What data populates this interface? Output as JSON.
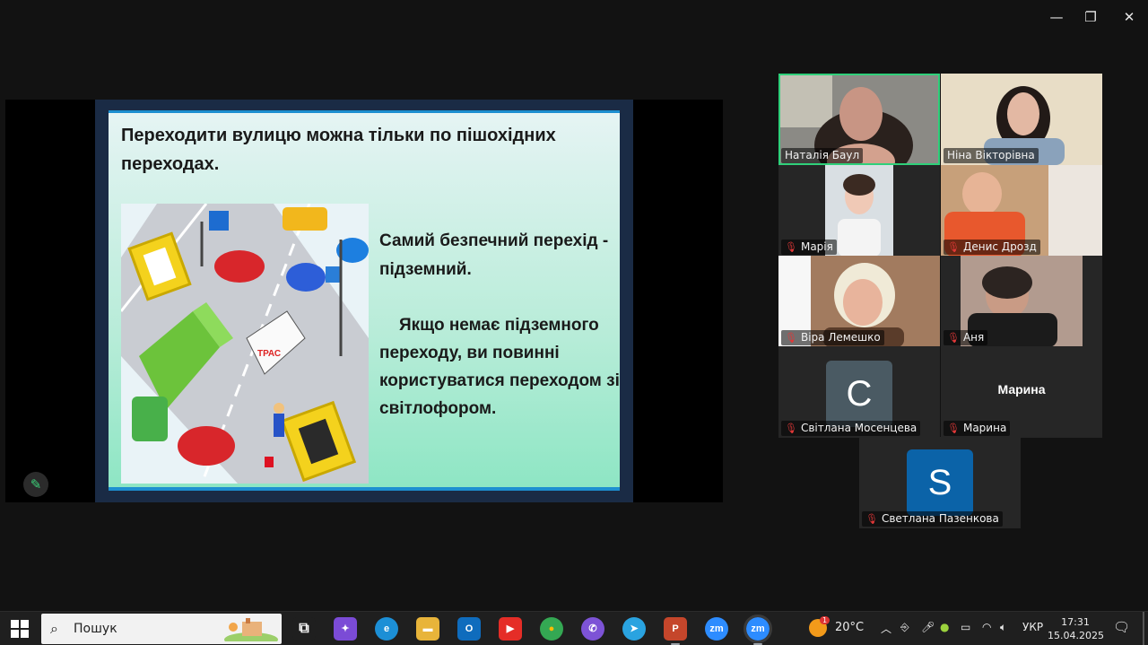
{
  "window": {
    "minimize_glyph": "—",
    "maximize_glyph": "❐",
    "close_glyph": "✕"
  },
  "slide": {
    "title": "Переходити вулицю можна тільки по пішохідних переходах.",
    "text1": "Самий безпечний перехід - підземний.",
    "text2": "Якщо немає підземного переходу, ви повинні користуватися переходом зі світлофором.",
    "illustration_sign": "ТРАС"
  },
  "annotate_icon": "pencil-icon",
  "participants": [
    {
      "name": "Наталія Баул",
      "muted": false,
      "active": true,
      "type": "video"
    },
    {
      "name": "Ніна Вікторівна",
      "muted": false,
      "active": false,
      "type": "video"
    },
    {
      "name": "Марія",
      "muted": true,
      "active": false,
      "type": "video"
    },
    {
      "name": "Денис Дрозд",
      "muted": true,
      "active": false,
      "type": "video"
    },
    {
      "name": "Віра Лемешко",
      "muted": true,
      "active": false,
      "type": "video"
    },
    {
      "name": "Аня",
      "muted": true,
      "active": false,
      "type": "video"
    },
    {
      "name": "Світлана  Мосенцева",
      "muted": true,
      "active": false,
      "type": "avatar",
      "initial": "С",
      "color": "#4a5a63"
    },
    {
      "name": "Марина",
      "muted": true,
      "active": false,
      "type": "name",
      "display": "Марина"
    },
    {
      "name": "Светлана Пазенкова",
      "muted": true,
      "active": false,
      "type": "avatar",
      "initial": "S",
      "color": "#0b63a8"
    }
  ],
  "taskbar": {
    "search_label": "Пошук",
    "apps": [
      {
        "name": "task-view",
        "glyph": "⧉",
        "color": "#1f1f1f"
      },
      {
        "name": "copilot",
        "glyph": "✦",
        "color": "#7b4bd6"
      },
      {
        "name": "edge",
        "glyph": "e",
        "color": "#1c8fd6"
      },
      {
        "name": "file-explorer",
        "glyph": "▬",
        "color": "#e8b43a"
      },
      {
        "name": "outlook",
        "glyph": "O",
        "color": "#0f6cbd"
      },
      {
        "name": "youtube",
        "glyph": "▶",
        "color": "#e52d27"
      },
      {
        "name": "chrome",
        "glyph": "●",
        "color": "#34a853"
      },
      {
        "name": "viber",
        "glyph": "✆",
        "color": "#7d53d6"
      },
      {
        "name": "telegram",
        "glyph": "➤",
        "color": "#2aa3e0"
      },
      {
        "name": "powerpoint",
        "glyph": "P",
        "color": "#c5462b"
      },
      {
        "name": "zoom",
        "glyph": "zm",
        "color": "#2d8cff"
      },
      {
        "name": "zoom-meeting",
        "glyph": "zm",
        "color": "#2d8cff"
      }
    ],
    "weather": "20°C",
    "weather_badge": "1",
    "language": "УКР",
    "time": "17:31",
    "date": "15.04.2025"
  }
}
